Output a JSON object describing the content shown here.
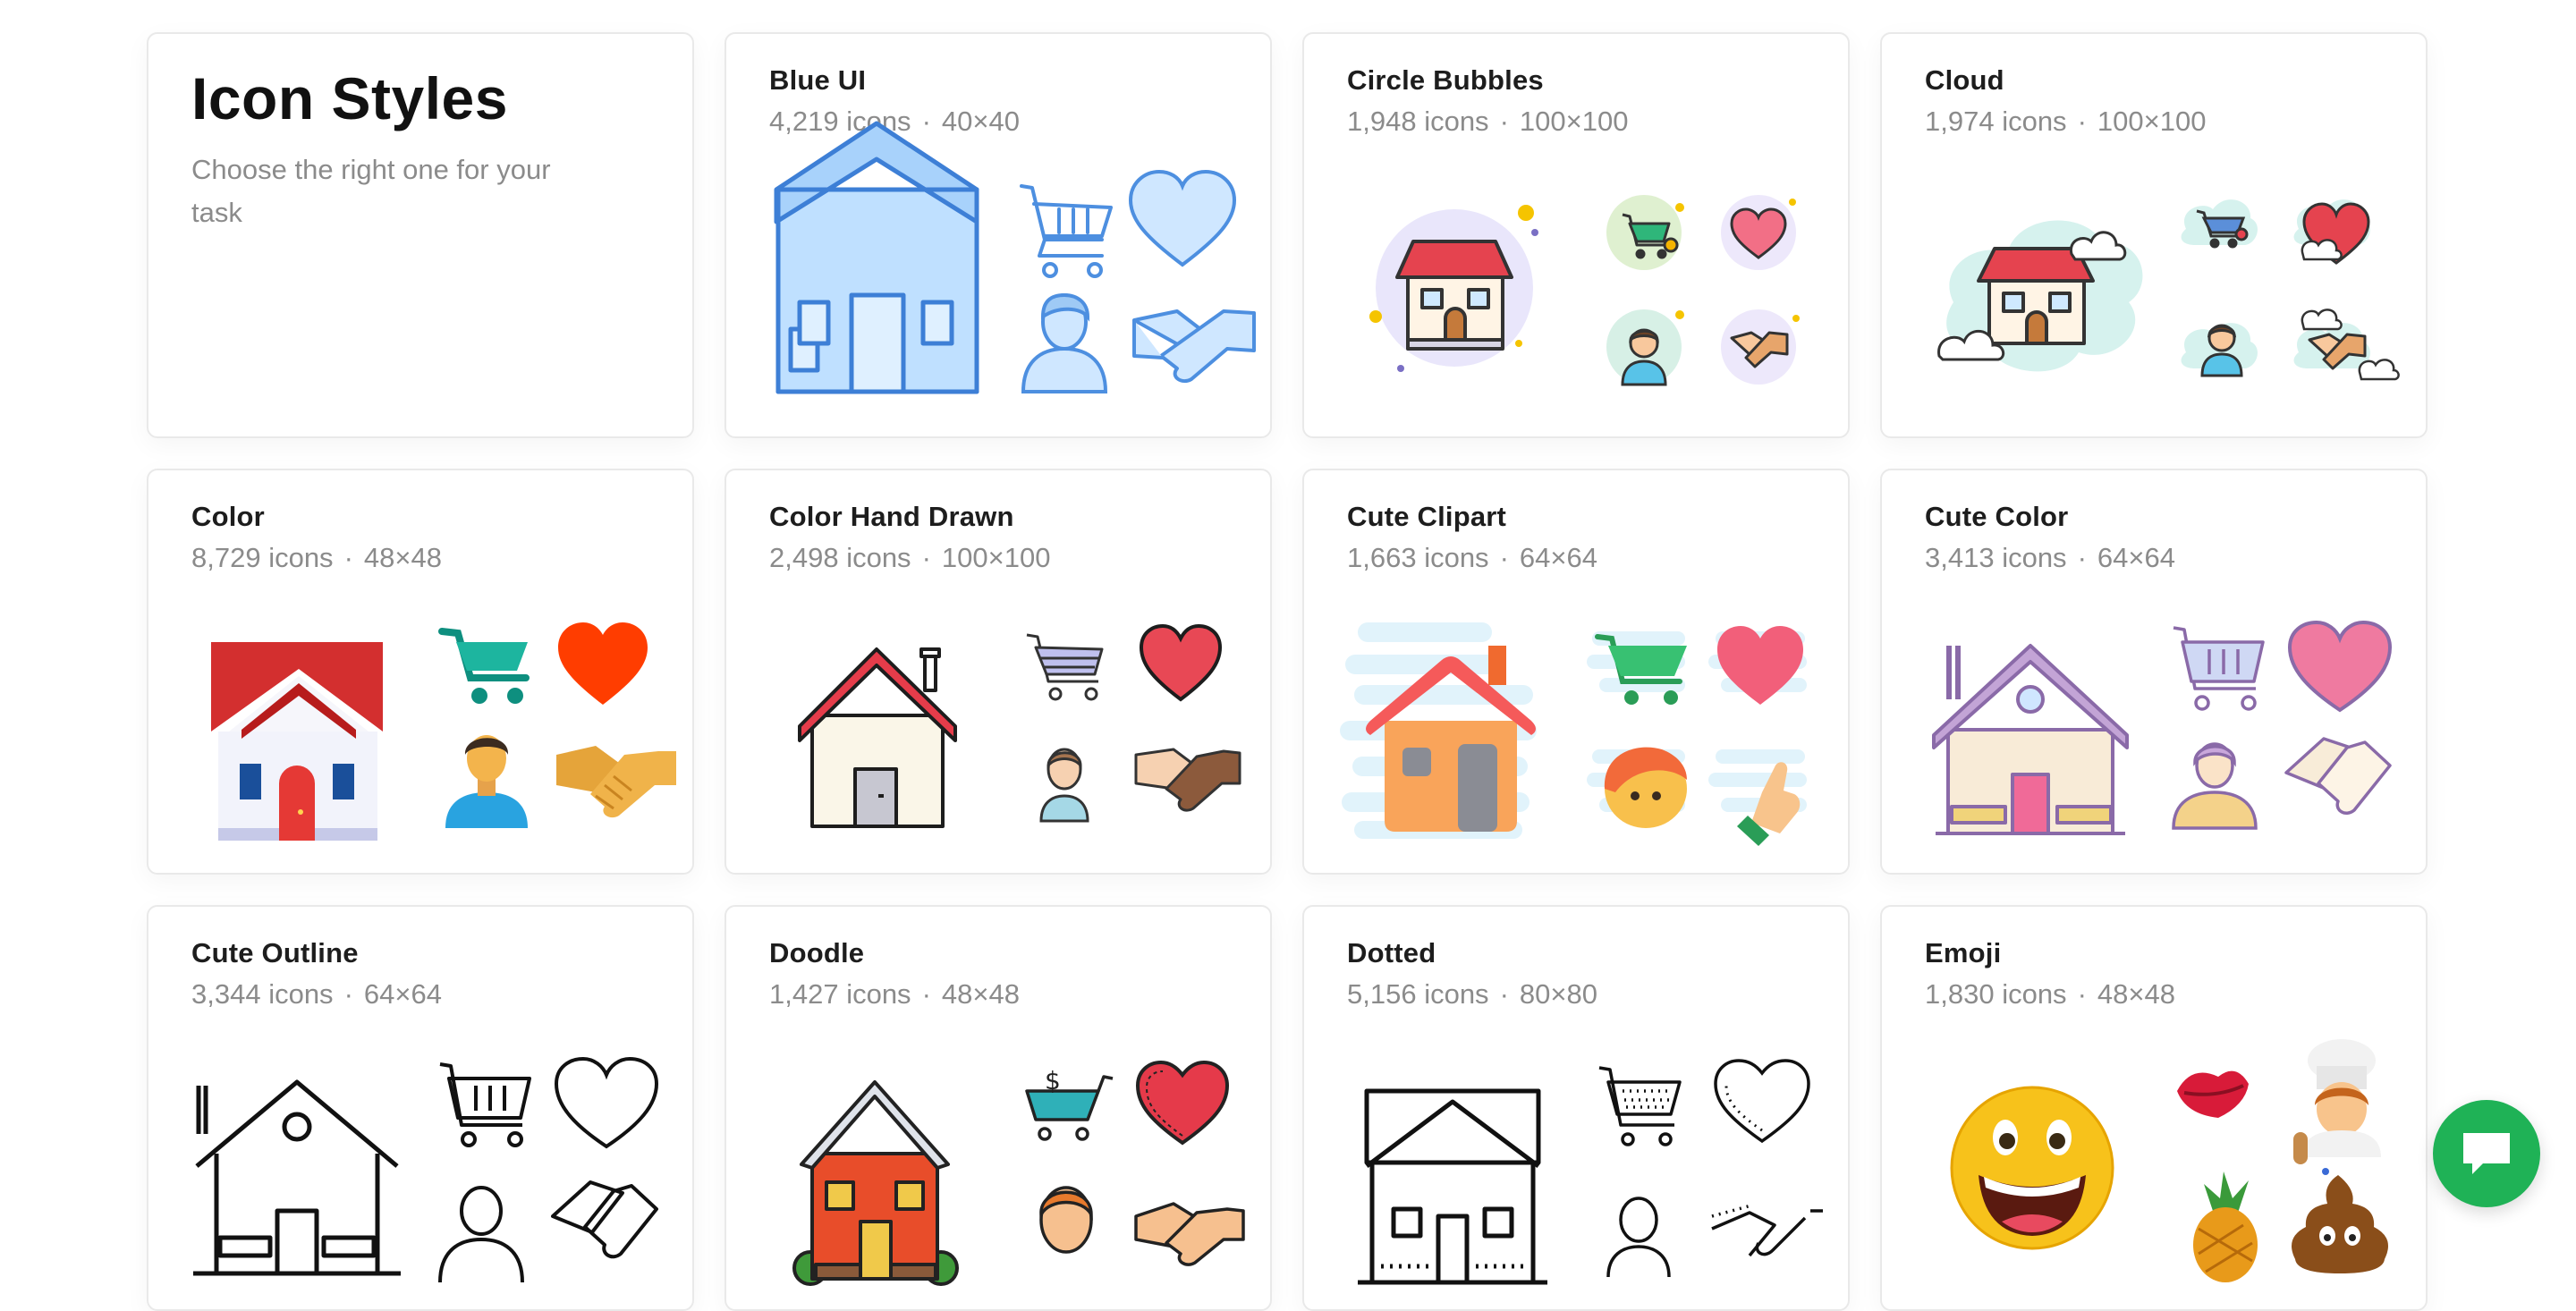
{
  "intro": {
    "title": "Icon Styles",
    "subtitle": "Choose the right one for your task"
  },
  "styles": [
    {
      "name": "Blue UI",
      "count": "4,219 icons",
      "size": "40×40"
    },
    {
      "name": "Circle Bubbles",
      "count": "1,948 icons",
      "size": "100×100"
    },
    {
      "name": "Cloud",
      "count": "1,974 icons",
      "size": "100×100"
    },
    {
      "name": "Color",
      "count": "8,729 icons",
      "size": "48×48"
    },
    {
      "name": "Color Hand Drawn",
      "count": "2,498 icons",
      "size": "100×100"
    },
    {
      "name": "Cute Clipart",
      "count": "1,663 icons",
      "size": "64×64"
    },
    {
      "name": "Cute Color",
      "count": "3,413 icons",
      "size": "64×64"
    },
    {
      "name": "Cute Outline",
      "count": "3,344 icons",
      "size": "64×64"
    },
    {
      "name": "Doodle",
      "count": "1,427 icons",
      "size": "48×48"
    },
    {
      "name": "Dotted",
      "count": "5,156 icons",
      "size": "80×80"
    },
    {
      "name": "Emoji",
      "count": "1,830 icons",
      "size": "48×48"
    }
  ],
  "separator": "·",
  "icons": {
    "preview_set": [
      "house-icon",
      "cart-icon",
      "heart-icon",
      "person-icon",
      "handshake-icon"
    ],
    "emoji_set": [
      "grinning-face-icon",
      "kiss-lips-icon",
      "chef-icon",
      "pineapple-icon",
      "poop-icon"
    ],
    "chat": "chat-bubble-icon"
  },
  "colors": {
    "chat_button": "#1fb256",
    "card_border": "#e9e9e9",
    "meta_text": "#8b8b8b"
  }
}
